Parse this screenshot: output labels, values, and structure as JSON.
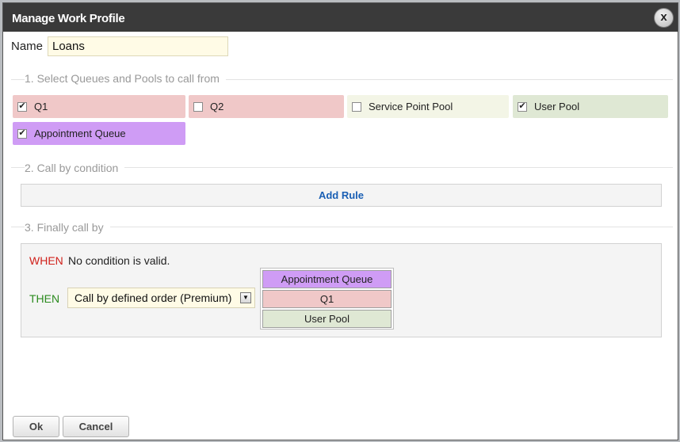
{
  "dialog": {
    "title": "Manage Work Profile",
    "close_label": "x"
  },
  "name_field": {
    "label": "Name",
    "value": "Loans"
  },
  "sections": {
    "queues_header": "1. Select Queues and Pools to call from",
    "condition_header": "2. Call by condition",
    "final_header": "3. Finally call by"
  },
  "queues": [
    {
      "label": "Q1",
      "checked": true,
      "color": "#f0c8c8"
    },
    {
      "label": "Q2",
      "checked": false,
      "color": "#f0c8c8"
    },
    {
      "label": "Service Point Pool",
      "checked": false,
      "color": "#f3f5e6"
    },
    {
      "label": "User Pool",
      "checked": true,
      "color": "#dfe8d4"
    },
    {
      "label": "Appointment Queue",
      "checked": true,
      "color": "#cf9cf5"
    }
  ],
  "add_rule_label": "Add Rule",
  "final": {
    "when_keyword": "WHEN",
    "when_text": "No condition is valid.",
    "then_keyword": "THEN",
    "order_select_value": "Call by defined order (Premium)",
    "order_items": [
      {
        "label": "Appointment Queue",
        "color": "#cf9cf5"
      },
      {
        "label": "Q1",
        "color": "#f0c8c8"
      },
      {
        "label": "User Pool",
        "color": "#dfe8d4"
      }
    ]
  },
  "buttons": {
    "ok_label": "Ok",
    "cancel_label": "Cancel"
  },
  "colors": {
    "titlebar": "#3a3a3a",
    "when": "#d0201a",
    "then": "#2a8a1e",
    "link": "#1a5fb4"
  },
  "icons": {
    "close": "close-icon",
    "dropdown": "chevron-down-icon",
    "checkbox": "checkbox-icon"
  }
}
